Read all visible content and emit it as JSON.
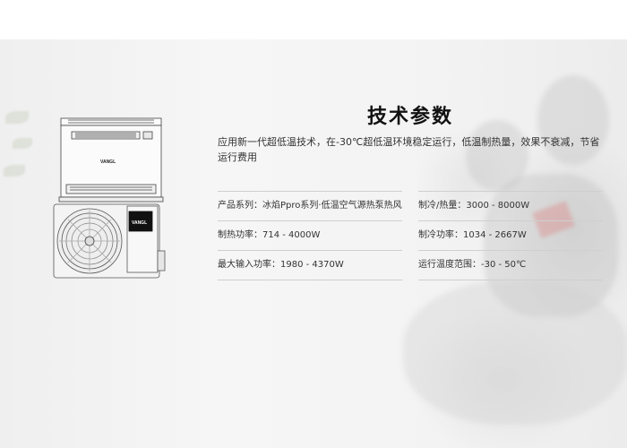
{
  "section": {
    "title": "技术参数",
    "description": "应用新一代超低温技术，在-30℃超低温环境稳定运行，低温制热量，效果不衰减，节省运行费用"
  },
  "product": {
    "brand_indoor": "VANGL",
    "brand_outdoor": "VANGL"
  },
  "specs": [
    {
      "left": "产品系列：冰焰Ppro系列·低温空气源热泵热风机",
      "right": "制冷/热量：3000 - 8000W"
    },
    {
      "left": "制热功率：714 - 4000W",
      "right": "制冷功率：1034 - 2667W"
    },
    {
      "left": "最大输入功率：1980 - 4370W",
      "right": "运行温度范围：-30 - 50℃"
    }
  ]
}
